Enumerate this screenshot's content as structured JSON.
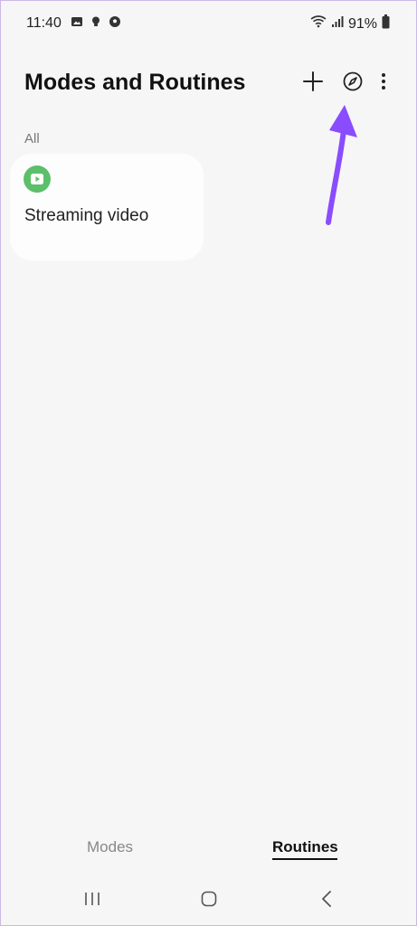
{
  "status_bar": {
    "time": "11:40",
    "battery": "91%",
    "left_icons": [
      "gallery-icon",
      "bulb-icon",
      "soccer-ball-icon"
    ],
    "right_icons": [
      "wifi-icon",
      "signal-icon",
      "battery-icon"
    ]
  },
  "header": {
    "title": "Modes and Routines",
    "actions": [
      "add-icon",
      "compass-icon",
      "more-vert-icon"
    ]
  },
  "section": {
    "label": "All"
  },
  "routines": [
    {
      "name": "Streaming video",
      "icon": "play-icon",
      "icon_color": "#5cbf6a"
    }
  ],
  "annotation": {
    "arrow_color": "#8a4cff",
    "points_to": "compass-icon"
  },
  "bottom_tabs": {
    "modes": "Modes",
    "routines": "Routines",
    "selected": "Routines"
  },
  "nav_bar": {
    "buttons": [
      "recents-icon",
      "home-icon",
      "back-icon"
    ]
  }
}
